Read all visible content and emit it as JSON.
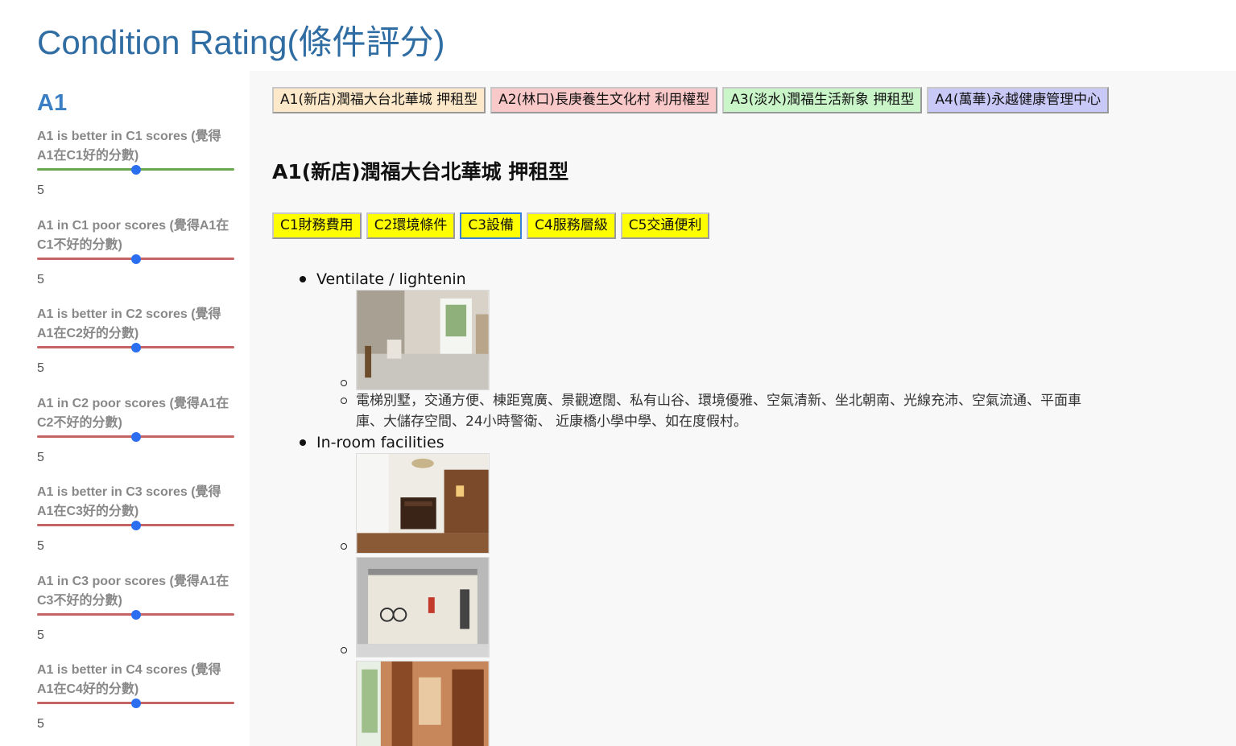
{
  "page_title": "Condition Rating(條件評分)",
  "colors": {
    "title": "#2f6da3",
    "slider_thumb": "#2b6ff0",
    "slider_green": "#6aa84f",
    "slider_red": "#c66464",
    "condition_tab": "#ffff00"
  },
  "sidebar": {
    "heading": "A1",
    "sliders": [
      {
        "label": "A1 is better in C1 scores (覺得A1在C1好的分數)",
        "value": "5",
        "rail_color": "green",
        "level": 0.5
      },
      {
        "label": "A1 in C1 poor scores (覺得A1在C1不好的分數)",
        "value": "5",
        "rail_color": "red",
        "level": 0.5
      },
      {
        "label": "A1 is better in C2 scores (覺得A1在C2好的分數)",
        "value": "5",
        "rail_color": "red",
        "level": 0.5
      },
      {
        "label": "A1 in C2 poor scores (覺得A1在C2不好的分數)",
        "value": "5",
        "rail_color": "red",
        "level": 0.5
      },
      {
        "label": "A1 is better in C3 scores (覺得A1在C3好的分數)",
        "value": "5",
        "rail_color": "red",
        "level": 0.5
      },
      {
        "label": "A1 in C3 poor scores (覺得A1在C3不好的分數)",
        "value": "5",
        "rail_color": "red",
        "level": 0.5
      },
      {
        "label": "A1 is better in C4 scores (覺得A1在C4好的分數)",
        "value": "5",
        "rail_color": "red",
        "level": 0.5
      }
    ]
  },
  "site_tabs": [
    {
      "label": "A1(新店)潤福大台北華城  押租型",
      "color": "#fde9c9"
    },
    {
      "label": "A2(林口)長庚養生文化村 利用權型",
      "color": "#f9c8c8"
    },
    {
      "label": "A3(淡水)潤福生活新象 押租型",
      "color": "#c9f5c9"
    },
    {
      "label": "A4(萬華)永越健康管理中心",
      "color": "#c9c9f8"
    }
  ],
  "site_heading": "A1(新店)潤福大台北華城 押租型",
  "condition_tabs": [
    {
      "label": "C1財務費用",
      "active": false
    },
    {
      "label": "C2環境條件",
      "active": false
    },
    {
      "label": "C3設備",
      "active": true
    },
    {
      "label": "C4服務層級",
      "active": false
    },
    {
      "label": "C5交通便利",
      "active": false
    }
  ],
  "content": {
    "ventilate_label": "Ventilate / lightenin",
    "ventilate_desc": "電梯別墅，交通方便、棟距寬廣、景觀遼闊、私有山谷、環境優雅、空氣清新、坐北朝南、光線充沛、空氣流通、平面車庫、大儲存空間、24小時警衛、 近康橋小學中學、如在度假村。",
    "facilities_label": "In-room facilities"
  }
}
